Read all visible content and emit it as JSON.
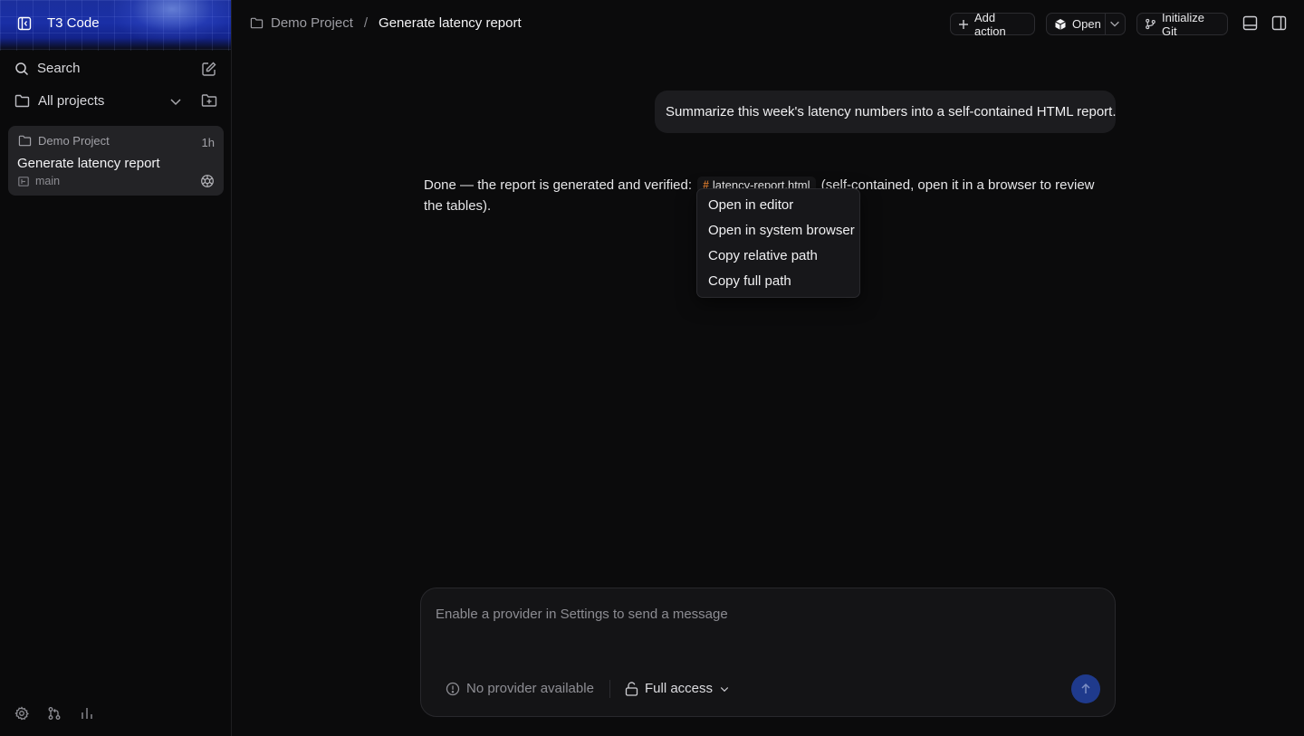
{
  "app": {
    "name": "T3 Code"
  },
  "sidebar": {
    "search_label": "Search",
    "projects_filter_label": "All projects",
    "thread": {
      "project": "Demo Project",
      "time": "1h",
      "title": "Generate latency report",
      "branch": "main"
    }
  },
  "header": {
    "breadcrumb_project": "Demo Project",
    "breadcrumb_separator": "/",
    "breadcrumb_current": "Generate latency report",
    "add_action_label": "Add action",
    "open_label": "Open",
    "init_git_label": "Initialize Git"
  },
  "conversation": {
    "user_message": "Summarize this week's latency numbers into a self-contained HTML report.",
    "assistant_prefix": "Done — the report is generated and verified:",
    "file_name": "latency-report.html",
    "assistant_suffix": "(self-contained, open it in a browser to review the tables)."
  },
  "context_menu": {
    "items": [
      "Open in editor",
      "Open in system browser",
      "Copy relative path",
      "Copy full path"
    ]
  },
  "composer": {
    "placeholder": "Enable a provider in Settings to send a message",
    "provider_status": "No provider available",
    "access_label": "Full access"
  },
  "colors": {
    "accent": "#1f3a8c",
    "file_hash": "#d97b2f",
    "background": "#0b0b0c"
  }
}
